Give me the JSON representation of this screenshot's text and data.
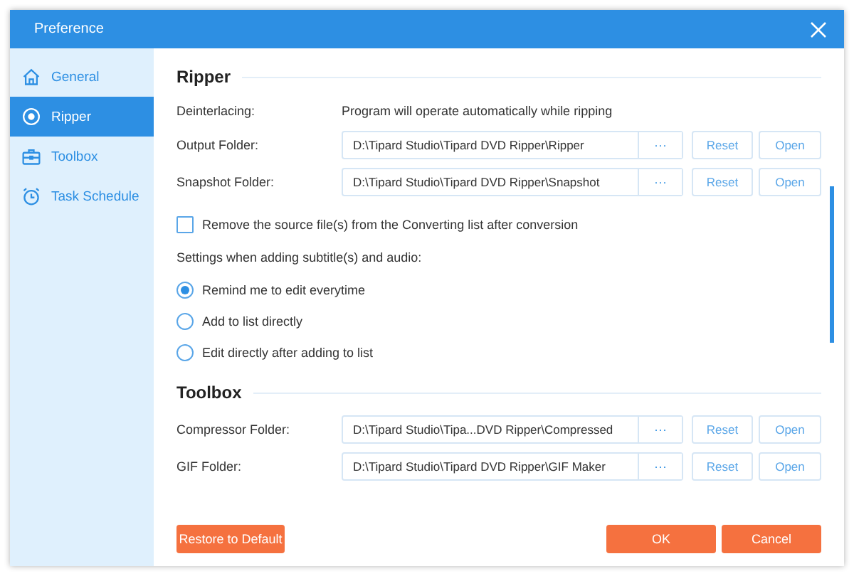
{
  "window": {
    "title": "Preference"
  },
  "sidebar": {
    "items": [
      {
        "label": "General",
        "selected": false
      },
      {
        "label": "Ripper",
        "selected": true
      },
      {
        "label": "Toolbox",
        "selected": false
      },
      {
        "label": "Task Schedule",
        "selected": false
      }
    ]
  },
  "sections": [
    {
      "heading": "Ripper",
      "items": [
        {
          "kind": "info",
          "label": "Deinterlacing:",
          "value": "Program will operate automatically while ripping"
        },
        {
          "kind": "folder",
          "label": "Output Folder:",
          "value": "D:\\Tipard Studio\\Tipard DVD Ripper\\Ripper",
          "browse": "···",
          "reset": "Reset",
          "open": "Open"
        },
        {
          "kind": "folder",
          "label": "Snapshot Folder:",
          "value": "D:\\Tipard Studio\\Tipard DVD Ripper\\Snapshot",
          "browse": "···",
          "reset": "Reset",
          "open": "Open"
        },
        {
          "kind": "checkbox",
          "label": "Remove the source file(s) from the Converting list after conversion",
          "checked": false
        },
        {
          "kind": "text",
          "label": "Settings when adding subtitle(s) and audio:"
        },
        {
          "kind": "radio",
          "label": "Remind me to edit everytime",
          "selected": true
        },
        {
          "kind": "radio",
          "label": "Add to list directly",
          "selected": false
        },
        {
          "kind": "radio",
          "label": "Edit directly after adding to list",
          "selected": false
        }
      ]
    },
    {
      "heading": "Toolbox",
      "items": [
        {
          "kind": "folder",
          "label": "Compressor Folder:",
          "value": "D:\\Tipard Studio\\Tipa...DVD Ripper\\Compressed",
          "browse": "···",
          "reset": "Reset",
          "open": "Open"
        },
        {
          "kind": "folder",
          "label": "GIF Folder:",
          "value": "D:\\Tipard Studio\\Tipard DVD Ripper\\GIF Maker",
          "browse": "···",
          "reset": "Reset",
          "open": "Open"
        }
      ]
    }
  ],
  "footer": {
    "restore": "Restore to Default",
    "ok": "OK",
    "cancel": "Cancel"
  }
}
